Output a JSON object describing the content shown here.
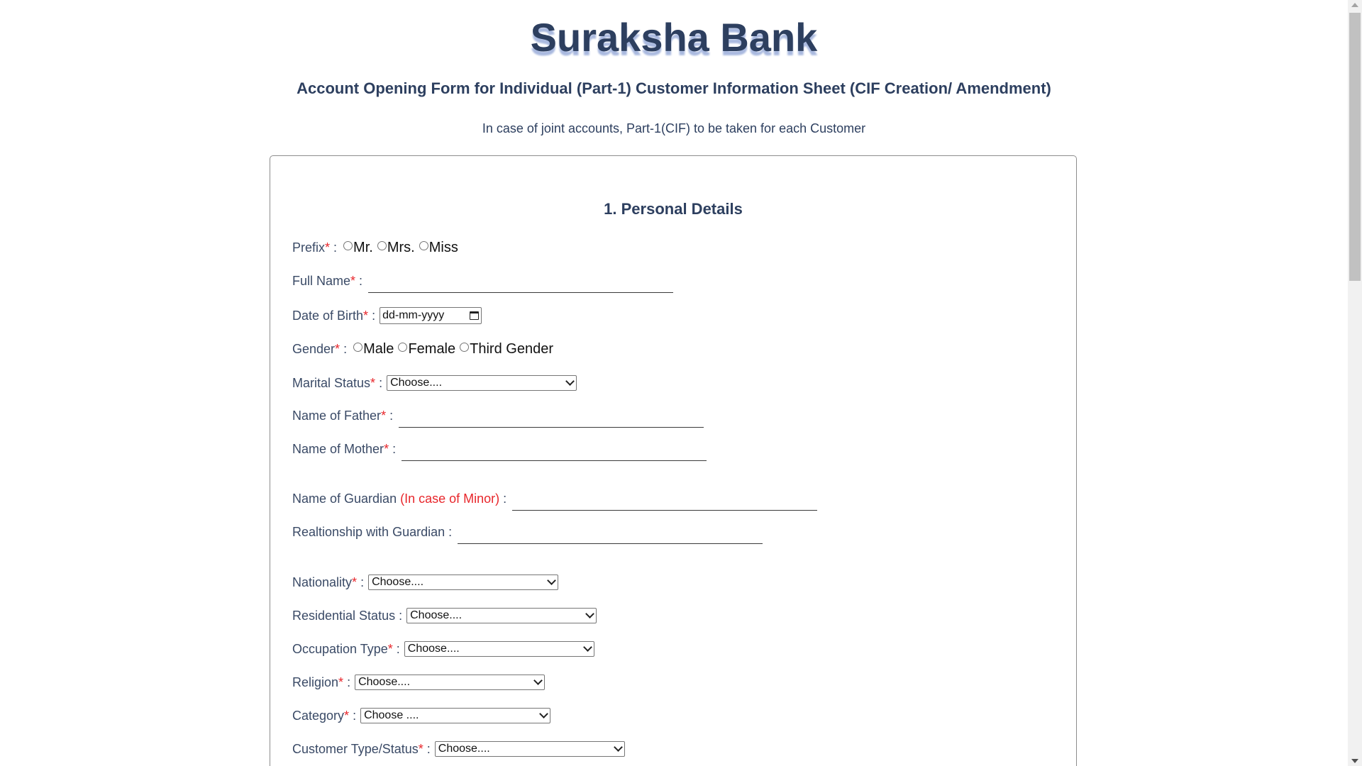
{
  "header": {
    "bank_name": "Suraksha Bank",
    "form_title": "Account Opening Form for Individual (Part-1) Customer Information Sheet (CIF Creation/ Amendment)",
    "subtitle": "In case of joint accounts, Part-1(CIF) to be taken for each Customer"
  },
  "section": {
    "title": "1. Personal Details"
  },
  "fields": {
    "required_mark": "*",
    "separator": ":",
    "prefix": {
      "label": "Prefix",
      "options": [
        "Mr.",
        "Mrs.",
        "Miss"
      ]
    },
    "full_name": {
      "label": "Full Name",
      "value": ""
    },
    "dob": {
      "label": "Date of Birth",
      "placeholder": "dd-mm-yyyy"
    },
    "gender": {
      "label": "Gender",
      "options": [
        "Male",
        "Female",
        "Third Gender"
      ]
    },
    "marital_status": {
      "label": "Marital Status",
      "selected": "Choose...."
    },
    "father_name": {
      "label": "Name of Father",
      "value": ""
    },
    "mother_name": {
      "label": "Name of Mother",
      "value": ""
    },
    "guardian_name": {
      "label": "Name of Guardian",
      "note": "(In case of Minor)",
      "value": ""
    },
    "guardian_relationship": {
      "label": "Realtionship with Guardian",
      "value": ""
    },
    "nationality": {
      "label": "Nationality",
      "selected": "Choose...."
    },
    "residential_status": {
      "label": "Residential Status",
      "selected": "Choose...."
    },
    "occupation_type": {
      "label": "Occupation Type",
      "selected": "Choose...."
    },
    "religion": {
      "label": "Religion",
      "selected": "Choose...."
    },
    "category": {
      "label": "Category",
      "selected": "Choose ...."
    },
    "customer_type": {
      "label": "Customer Type/Status",
      "selected": "Choose...."
    }
  },
  "colors": {
    "heading": "#2d3f5f",
    "title_shadow": "#a9b9df",
    "required": "#e8262b",
    "card_border": "#8d8d8d"
  }
}
